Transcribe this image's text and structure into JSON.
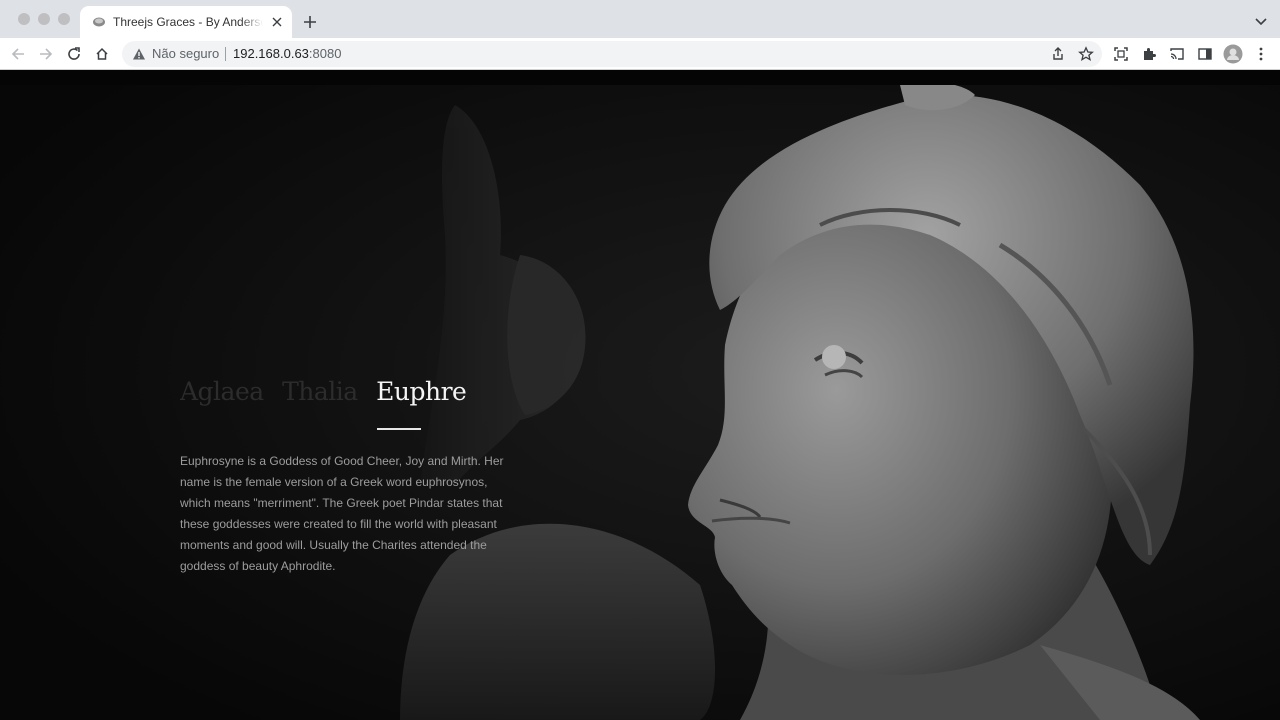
{
  "browser": {
    "tab_title": "Threejs Graces - By Anderson Mancini",
    "security_label": "Não seguro",
    "url_host": "192.168.0.63",
    "url_port": ":8080"
  },
  "page": {
    "titles": [
      "Aglaea",
      "Thalia",
      "Euphre"
    ],
    "active_title_index": 2,
    "description": "Euphrosyne is a Goddess of Good Cheer, Joy and Mirth. Her name is the female version of a Greek word euphrosynos, which means \"merriment\". The Greek poet Pindar states that these goddesses were created to fill the world with pleasant moments and good will. Usually the Charites attended the goddess of beauty Aphrodite."
  },
  "icons": {
    "favicon": "statue-favicon-icon",
    "back": "back-arrow-icon",
    "forward": "forward-arrow-icon",
    "reload": "reload-icon",
    "home": "home-icon",
    "warning": "warning-triangle-icon",
    "share": "share-icon",
    "bookmark": "star-icon",
    "screenshot": "screen-capture-icon",
    "extensions": "puzzle-icon",
    "cast": "cast-icon",
    "sidepanel": "side-panel-icon",
    "profile": "avatar",
    "menu": "kebab-menu-icon"
  }
}
